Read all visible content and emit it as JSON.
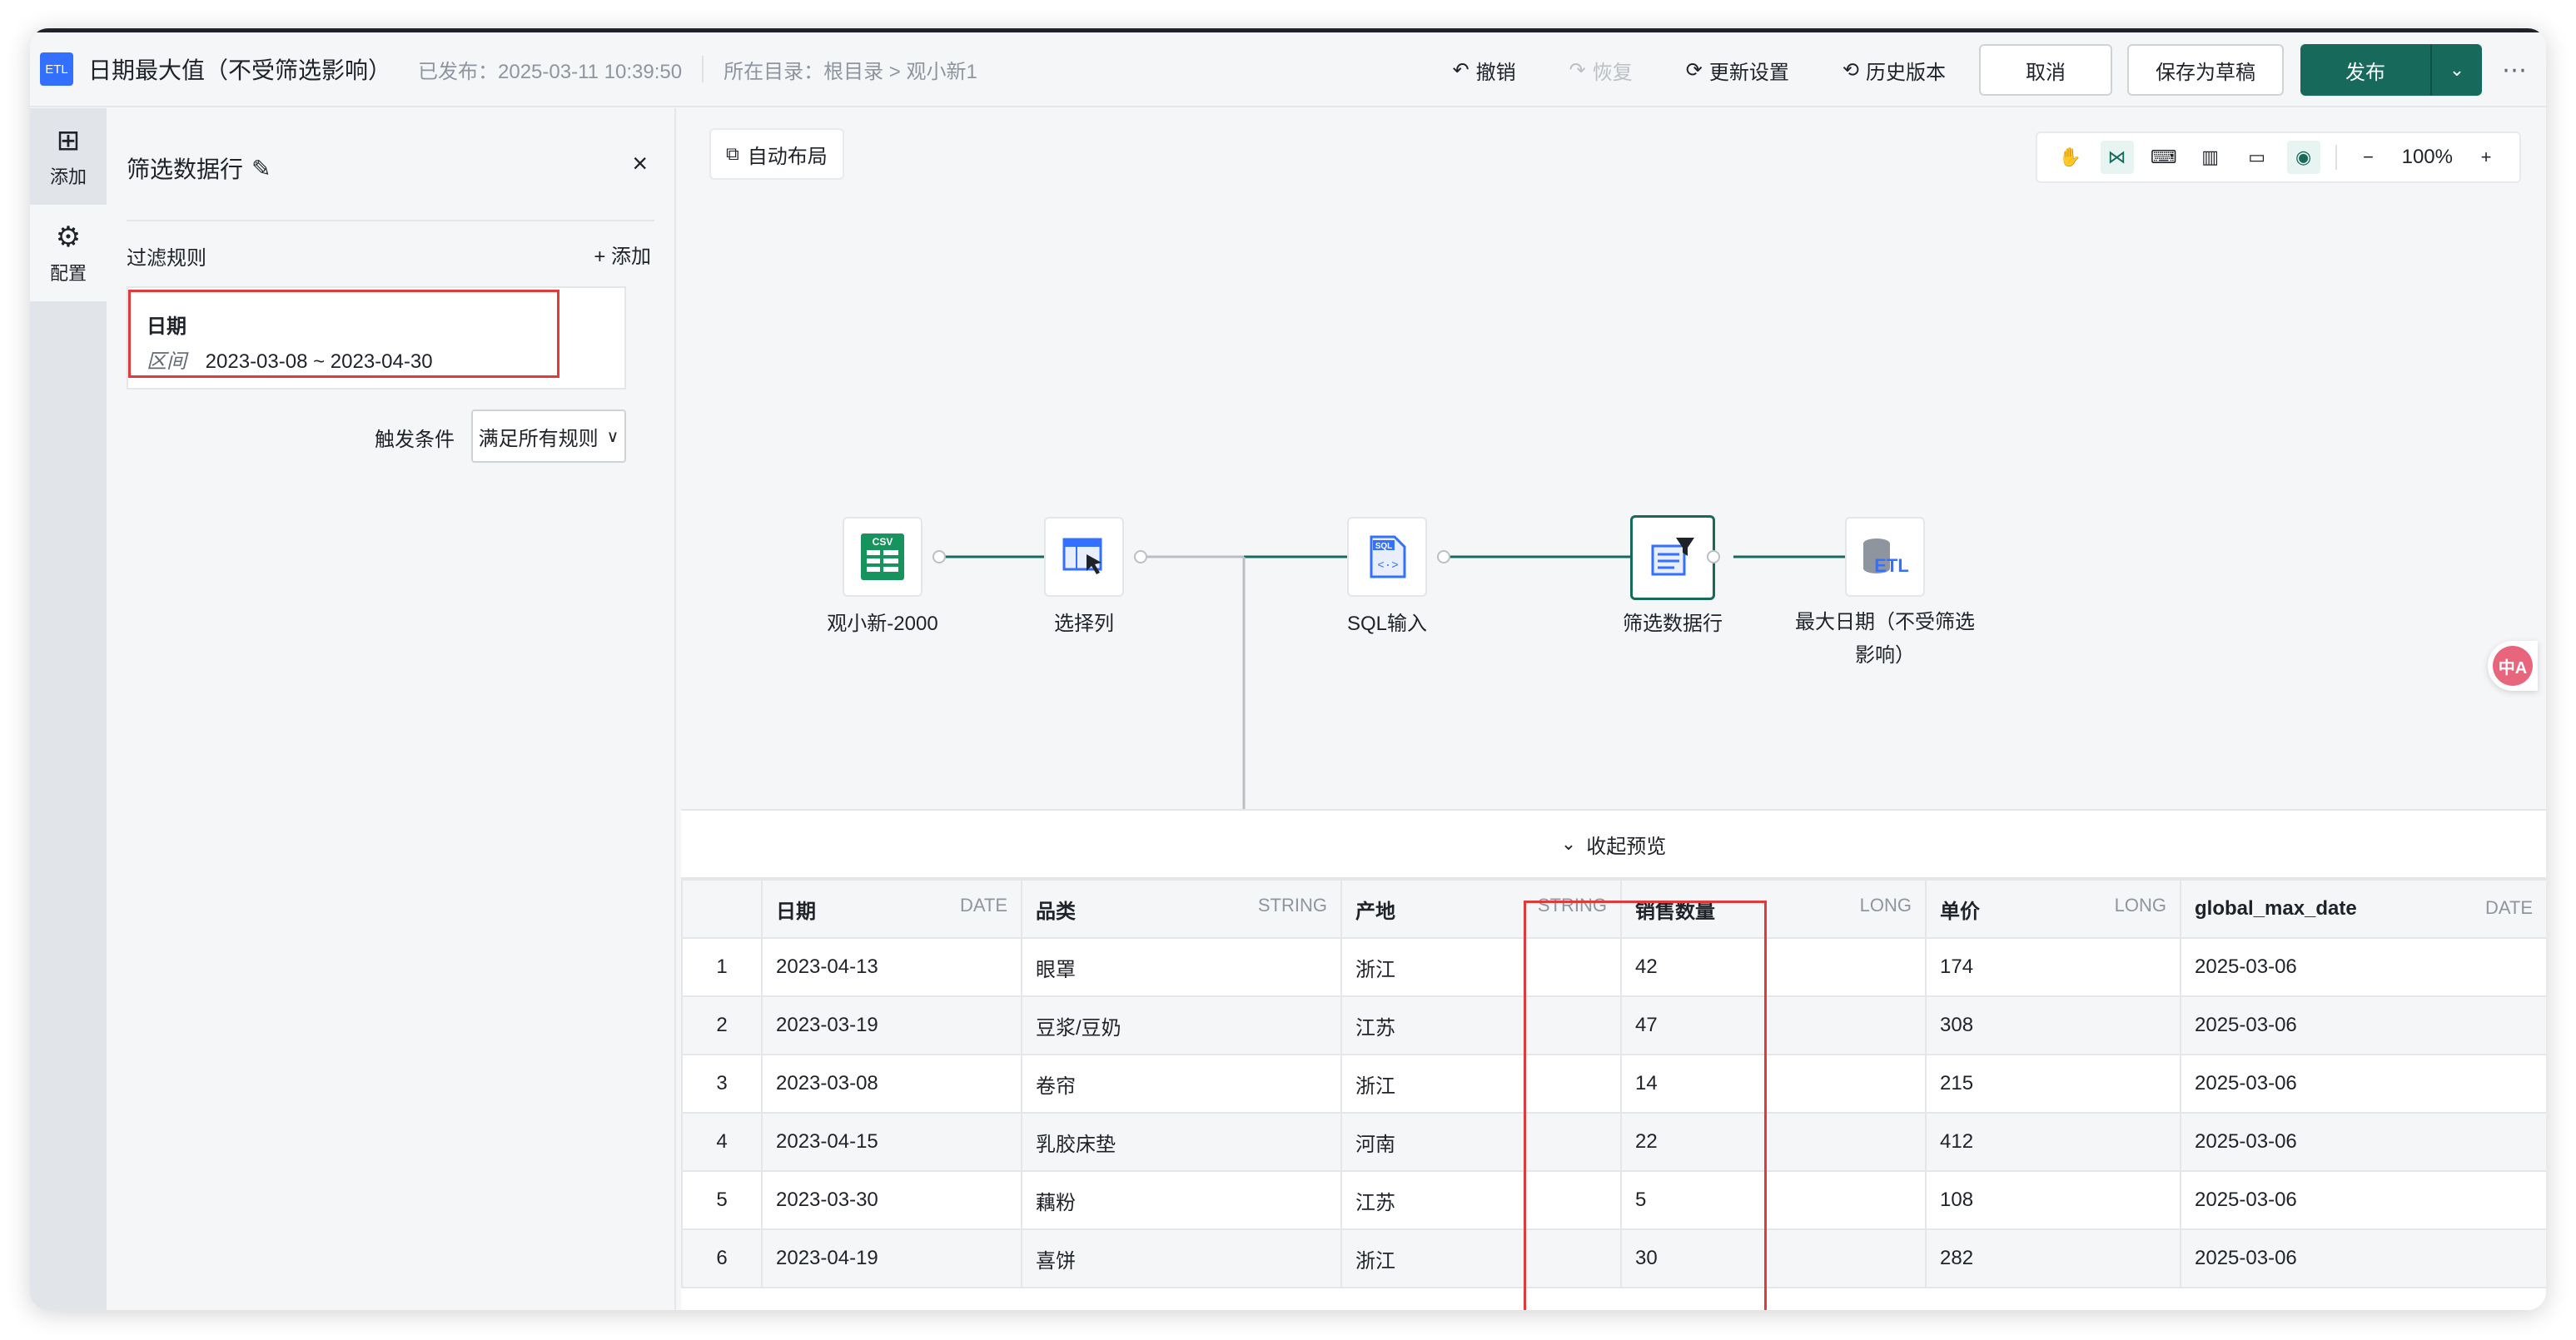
{
  "header": {
    "badge": "ETL",
    "title": "日期最大值（不受筛选影响）",
    "published": "已发布：2025-03-11 10:39:50",
    "location": "所在目录：根目录 > 观小新1",
    "undo": "撤销",
    "redo": "恢复",
    "update_settings": "更新设置",
    "history": "历史版本",
    "cancel": "取消",
    "save_draft": "保存为草稿",
    "publish": "发布"
  },
  "rail": {
    "add": "添加",
    "config": "配置"
  },
  "panel": {
    "title": "筛选数据行",
    "rules_label": "过滤规则",
    "add_rule": "+ 添加",
    "rule": {
      "field": "日期",
      "kind": "区间",
      "range": "2023-03-08 ~ 2023-04-30"
    },
    "trigger_label": "触发条件",
    "trigger_value": "满足所有规则"
  },
  "canvas": {
    "auto_layout": "自动布局",
    "zoom": "100%",
    "nodes": [
      {
        "label": "观小新-2000",
        "icon": "csv-icon"
      },
      {
        "label": "选择列",
        "icon": "select-columns-icon"
      },
      {
        "label": "SQL输入",
        "icon": "sql-icon"
      },
      {
        "label": "筛选数据行",
        "icon": "filter-rows-icon"
      },
      {
        "label": "最大日期（不受筛选",
        "label2": "影响）",
        "icon": "etl-output-icon"
      }
    ]
  },
  "preview": {
    "collapse": "收起预览",
    "columns": [
      {
        "name": "日期",
        "type": "DATE"
      },
      {
        "name": "品类",
        "type": "STRING"
      },
      {
        "name": "产地",
        "type": "STRING"
      },
      {
        "name": "销售数量",
        "type": "LONG"
      },
      {
        "name": "单价",
        "type": "LONG"
      },
      {
        "name": "global_max_date",
        "type": "DATE"
      }
    ],
    "rows": [
      [
        "1",
        "2023-04-13",
        "眼罩",
        "浙江",
        "42",
        "174",
        "2025-03-06"
      ],
      [
        "2",
        "2023-03-19",
        "豆浆/豆奶",
        "江苏",
        "47",
        "308",
        "2025-03-06"
      ],
      [
        "3",
        "2023-03-08",
        "卷帘",
        "浙江",
        "14",
        "215",
        "2025-03-06"
      ],
      [
        "4",
        "2023-04-15",
        "乳胶床垫",
        "河南",
        "22",
        "412",
        "2025-03-06"
      ],
      [
        "5",
        "2023-03-30",
        "藕粉",
        "江苏",
        "5",
        "108",
        "2025-03-06"
      ],
      [
        "6",
        "2023-04-19",
        "喜饼",
        "浙江",
        "30",
        "282",
        "2025-03-06"
      ]
    ]
  }
}
